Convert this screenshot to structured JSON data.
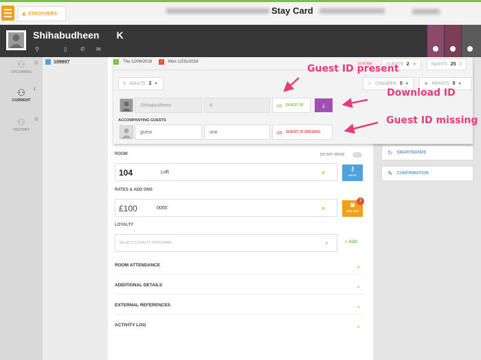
{
  "topbar": {
    "back_label": "STAYOVERS",
    "title": "Stay Card"
  },
  "header": {
    "first_name": "Shihabudheen",
    "last_name": "K",
    "tile_colors": [
      "#8c4a6a",
      "#7a3e55",
      "#5a5a5a"
    ]
  },
  "sidebar": {
    "items": [
      {
        "label": "UPCOMING",
        "icon": "user-luggage-icon"
      },
      {
        "label": "CURRENT",
        "icon": "user-bed-icon",
        "count": "1"
      },
      {
        "label": "HISTORY",
        "icon": "user-history-icon"
      }
    ],
    "room_number": "109907"
  },
  "stay": {
    "arrival": "Thu 12/06/2018",
    "departure": "Mon 12/31/2018",
    "time": "10:00 AM",
    "guests_label": "GUESTS",
    "guests_value": "2",
    "nights_label": "NIGHTS",
    "nights_value": "25",
    "adults_label": "ADULTS",
    "adults_value": "2",
    "children_label": "CHILDREN",
    "children_value": "0",
    "infants_label": "INFANTS",
    "infants_value": "0"
  },
  "primary_guest": {
    "first": "Shihabudheen",
    "last": "K",
    "id_button": "GUEST ID"
  },
  "accompanying": {
    "label": "ACCOMPANYING GUESTS",
    "first": "guest",
    "last": "one",
    "id_button": "GUEST ID MISSING"
  },
  "room": {
    "label": "ROOM",
    "do_not_move": "DO NOT MOVE",
    "number": "104",
    "type": "Loft",
    "keys_label": "KEYS"
  },
  "rates": {
    "label": "RATES & ADD ONS",
    "amount": "£100",
    "code": "0000",
    "addons_label": "ADD-ONS",
    "addons_count": "1"
  },
  "loyalty": {
    "label": "LOYALTY",
    "placeholder": "SELECT LOYALTY PROGRAM",
    "add_label": "+ ADD"
  },
  "sections": [
    "ROOM ATTENDANCE",
    "ADDITIONAL DETAILS",
    "EXTERNAL REFERENCES",
    "ACTIVITY LOG"
  ],
  "right_cards": [
    "SMARTBANDS",
    "CONFIRMATION"
  ],
  "annotations": {
    "present": "Guest ID present",
    "download": "Download ID",
    "missing": "Guest ID missing"
  },
  "colors": {
    "accent": "#f0a11c",
    "green": "#7ac143",
    "red": "#e0533a",
    "purple": "#a14fb3",
    "blue": "#4fa3d9",
    "annotation": "#e83b7a"
  }
}
